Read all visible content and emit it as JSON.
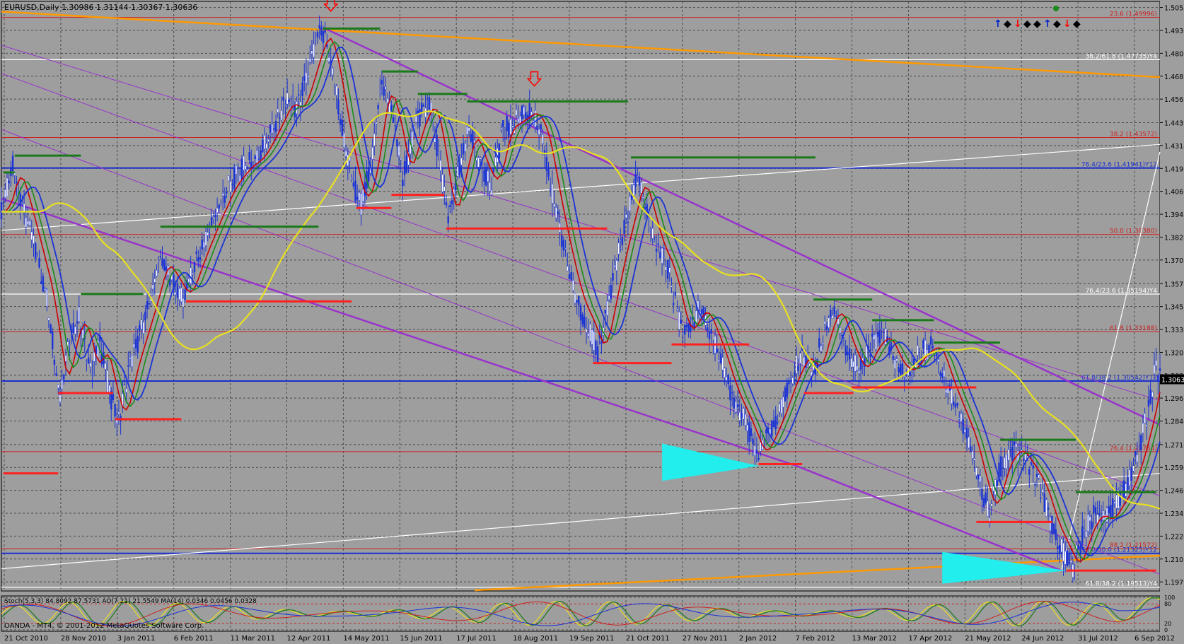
{
  "chart_data": {
    "type": "candlestick",
    "symbol": "EURUSD",
    "timeframe": "Daily",
    "ohlc": {
      "open": "1.30986",
      "high": "1.31144",
      "low": "1.30367",
      "close": "1.30636"
    },
    "header": "EURUSD,Daily  1.30986 1.31144 1.30367 1.30636",
    "current_price_label": "1.30636",
    "ylim": [
      1.1931,
      1.5085
    ],
    "y_ticks": [
      "1.50525",
      "1.49300",
      "1.48075",
      "1.46850",
      "1.45625",
      "1.44365",
      "1.43140",
      "1.41915",
      "1.40690",
      "1.39465",
      "1.38240",
      "1.37015",
      "1.35750",
      "1.34525",
      "1.33300",
      "1.32075",
      "1.30850",
      "1.29630",
      "1.28400",
      "1.27145",
      "1.25920",
      "1.24695",
      "1.23470",
      "1.22245",
      "1.21020",
      "1.19795"
    ],
    "x_ticks": [
      "21 Oct 2010",
      "28 Nov 2010",
      "3 Jan 2011",
      "6 Feb 2011",
      "11 Mar 2011",
      "12 Apr 2011",
      "14 May 2011",
      "15 Jun 2011",
      "17 Jul 2011",
      "18 Aug 2011",
      "19 Sep 2011",
      "21 Oct 2011",
      "27 Nov 2011",
      "2 Jan 2012",
      "7 Feb 2012",
      "13 Mar 2012",
      "17 Apr 2012",
      "21 May 2012",
      "24 Jun 2012",
      "31 Jul 2012",
      "6 Sep 2012"
    ],
    "price_path": [
      [
        1.396,
        0
      ],
      [
        1.42,
        12
      ],
      [
        1.39,
        28
      ],
      [
        1.37,
        38
      ],
      [
        1.35,
        48
      ],
      [
        1.32,
        56
      ],
      [
        1.3,
        62
      ],
      [
        1.33,
        72
      ],
      [
        1.34,
        82
      ],
      [
        1.31,
        94
      ],
      [
        1.325,
        104
      ],
      [
        1.295,
        116
      ],
      [
        1.285,
        124
      ],
      [
        1.31,
        134
      ],
      [
        1.33,
        146
      ],
      [
        1.35,
        158
      ],
      [
        1.37,
        168
      ],
      [
        1.36,
        180
      ],
      [
        1.35,
        192
      ],
      [
        1.37,
        206
      ],
      [
        1.39,
        222
      ],
      [
        1.41,
        240
      ],
      [
        1.42,
        256
      ],
      [
        1.425,
        270
      ],
      [
        1.44,
        286
      ],
      [
        1.455,
        300
      ],
      [
        1.45,
        312
      ],
      [
        1.47,
        324
      ],
      [
        1.49,
        336
      ],
      [
        1.49,
        342
      ],
      [
        1.465,
        352
      ],
      [
        1.435,
        362
      ],
      [
        1.41,
        372
      ],
      [
        1.4,
        380
      ],
      [
        1.42,
        390
      ],
      [
        1.465,
        402
      ],
      [
        1.445,
        414
      ],
      [
        1.415,
        424
      ],
      [
        1.445,
        440
      ],
      [
        1.455,
        452
      ],
      [
        1.42,
        464
      ],
      [
        1.39,
        472
      ],
      [
        1.415,
        482
      ],
      [
        1.44,
        494
      ],
      [
        1.42,
        506
      ],
      [
        1.41,
        518
      ],
      [
        1.44,
        530
      ],
      [
        1.445,
        545
      ],
      [
        1.45,
        560
      ],
      [
        1.435,
        572
      ],
      [
        1.41,
        580
      ],
      [
        1.38,
        592
      ],
      [
        1.35,
        606
      ],
      [
        1.335,
        620
      ],
      [
        1.32,
        630
      ],
      [
        1.37,
        650
      ],
      [
        1.415,
        672
      ],
      [
        1.38,
        690
      ],
      [
        1.365,
        704
      ],
      [
        1.33,
        720
      ],
      [
        1.345,
        738
      ],
      [
        1.325,
        754
      ],
      [
        1.3,
        770
      ],
      [
        1.285,
        784
      ],
      [
        1.265,
        800
      ],
      [
        1.285,
        818
      ],
      [
        1.305,
        832
      ],
      [
        1.32,
        846
      ],
      [
        1.31,
        858
      ],
      [
        1.335,
        870
      ],
      [
        1.345,
        880
      ],
      [
        1.325,
        892
      ],
      [
        1.31,
        906
      ],
      [
        1.325,
        920
      ],
      [
        1.33,
        932
      ],
      [
        1.315,
        944
      ],
      [
        1.31,
        956
      ],
      [
        1.32,
        970
      ],
      [
        1.325,
        985
      ],
      [
        1.305,
        998
      ],
      [
        1.29,
        1010
      ],
      [
        1.275,
        1022
      ],
      [
        1.25,
        1034
      ],
      [
        1.235,
        1044
      ],
      [
        1.26,
        1056
      ],
      [
        1.27,
        1070
      ],
      [
        1.26,
        1084
      ],
      [
        1.25,
        1096
      ],
      [
        1.23,
        1108
      ],
      [
        1.215,
        1122
      ],
      [
        1.205,
        1132
      ],
      [
        1.225,
        1144
      ],
      [
        1.235,
        1156
      ],
      [
        1.23,
        1166
      ],
      [
        1.24,
        1178
      ],
      [
        1.25,
        1190
      ],
      [
        1.27,
        1202
      ],
      [
        1.295,
        1214
      ],
      [
        1.315,
        1220
      ],
      [
        1.3064,
        1224
      ]
    ],
    "fib_levels": [
      {
        "label": "23.6 (1.49996)",
        "value": 1.49996,
        "color": "#cc2222"
      },
      {
        "label": "38.2 (1.43572)",
        "value": 1.43572,
        "color": "#cc2222"
      },
      {
        "label": "50.0 (1.38380)",
        "value": 1.3838,
        "color": "#cc2222"
      },
      {
        "label": "61.8 (1.33188)",
        "value": 1.33188,
        "color": "#cc2222"
      },
      {
        "label": "76.4 (1.26764)",
        "value": 1.26764,
        "color": "#cc2222"
      },
      {
        "label": "88.2 (1.21572)",
        "value": 1.21572,
        "color": "#cc2222"
      }
    ],
    "blue_levels": [
      {
        "label": "76.4/23.6 (1.41941)Y12",
        "value": 1.41941
      },
      {
        "label": "61.8/38.2 (1.30542)Y12",
        "value": 1.30542
      },
      {
        "label": "50.0/50.0 (1.21325)Y12",
        "value": 1.21325
      }
    ],
    "white_levels": [
      {
        "label": "38.2/61.8 (1.47735)Y4",
        "value": 1.47735
      },
      {
        "label": "76.4/23.6 (1.35194)Y4",
        "value": 1.35194
      },
      {
        "label": "61.8/38.2 (1.19513)Y4",
        "value": 1.19513
      }
    ],
    "indicator_label": "Stoch(5,3,3) 84.8092 87.5731  AO(7,21) 21.5549  MA(14) 0.0346 0.0456 0.0328",
    "osc_levels": [
      "100",
      "80",
      "20",
      "0"
    ],
    "copyright": "OANDA - MT4, © 2001-2012 MetaQuotes Software Corp.",
    "fractal_marks": [
      "↑",
      "◆",
      "↓",
      "◆",
      "◆",
      "↑",
      "◆",
      "↓",
      "◆"
    ],
    "colors": {
      "background": "#9e9e9e",
      "grid": "#4a4a4a",
      "candle": "#1a33d6",
      "ma_fast": "#cc0000",
      "ma_mid": "#1a8a1a",
      "ma_slow": "#1a33d6",
      "ma_long": "#e8e020",
      "channel": "#9933cc",
      "support": "#ff2020",
      "resistance": "#1a7a1a",
      "orange": "#ff9900",
      "cyan": "#22eeee"
    }
  }
}
